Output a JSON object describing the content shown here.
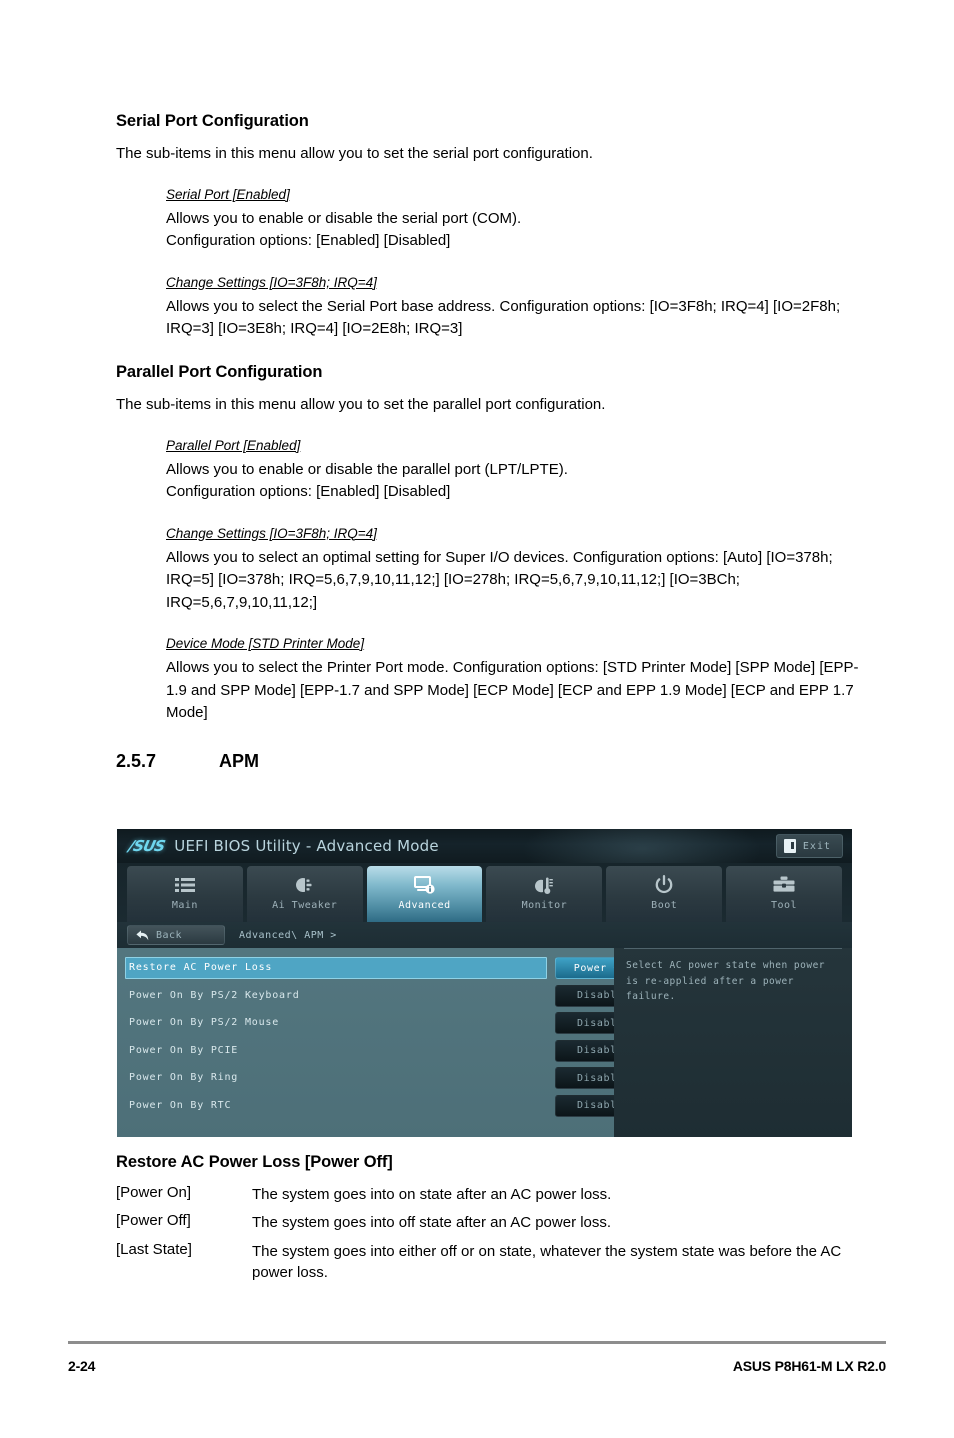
{
  "document": {
    "sections": [
      {
        "heading": "Serial Port Configuration",
        "intro": "The sub-items in this menu allow you to set the serial port configuration.",
        "items": [
          {
            "title": "Serial Port [Enabled]",
            "lines": [
              "Allows you to enable or disable the serial port (COM).",
              "Configuration options: [Enabled] [Disabled]"
            ]
          },
          {
            "title": "Change Settings [IO=3F8h; IRQ=4]",
            "lines": [
              "Allows you to select the Serial Port base address. Configuration options: [IO=3F8h; IRQ=4] [IO=2F8h; IRQ=3] [IO=3E8h; IRQ=4] [IO=2E8h; IRQ=3]"
            ]
          }
        ]
      },
      {
        "heading": "Parallel Port Configuration",
        "intro": "The sub-items in this menu allow you to set the parallel port configuration.",
        "items": [
          {
            "title": "Parallel Port [Enabled]",
            "lines": [
              "Allows you to enable or disable the parallel port (LPT/LPTE).",
              "Configuration options: [Enabled] [Disabled]"
            ]
          },
          {
            "title": "Change Settings [IO=3F8h; IRQ=4]",
            "lines": [
              "Allows you to select an optimal setting for Super I/O devices. Configuration options: [Auto] [IO=378h; IRQ=5] [IO=378h; IRQ=5,6,7,9,10,11,12;] [IO=278h; IRQ=5,6,7,9,10,11,12;] [IO=3BCh; IRQ=5,6,7,9,10,11,12;]"
            ]
          },
          {
            "title": "Device Mode [STD Printer Mode]",
            "lines": [
              "Allows you to select the Printer Port mode. Configuration options: [STD Printer Mode] [SPP Mode] [EPP-1.9 and SPP Mode] [EPP-1.7 and SPP Mode] [ECP Mode] [ECP and EPP 1.9 Mode] [ECP and EPP 1.7 Mode]"
            ]
          }
        ]
      }
    ],
    "numbered_heading": {
      "number": "2.5.7",
      "title": "APM"
    },
    "setting_heading": "Restore AC Power Loss [Power Off]",
    "definitions": [
      {
        "key": "[Power On]",
        "value": "The system goes into on state after an AC power loss."
      },
      {
        "key": "[Power Off]",
        "value": "The system goes into off state after an AC power loss."
      },
      {
        "key": "[Last State]",
        "value": "The system goes into either off or on state, whatever the system state was before the AC power loss."
      }
    ]
  },
  "bios": {
    "logo": "/SUS",
    "title": "UEFI BIOS Utility - Advanced Mode",
    "exit_label": "Exit",
    "tabs": [
      {
        "label": "Main",
        "icon": "list-icon",
        "active": false
      },
      {
        "label": "Ai Tweaker",
        "icon": "tweak-icon",
        "active": false
      },
      {
        "label": "Advanced",
        "icon": "advanced-monitor-icon",
        "active": true
      },
      {
        "label": "Monitor",
        "icon": "thermometer-fan-icon",
        "active": false
      },
      {
        "label": "Boot",
        "icon": "power-icon",
        "active": false
      },
      {
        "label": "Tool",
        "icon": "toolbox-icon",
        "active": false
      }
    ],
    "back_label": "Back",
    "breadcrumb": "Advanced\\ APM >",
    "settings": [
      {
        "name": "Restore AC Power Loss",
        "value": "Power Off",
        "selected": true
      },
      {
        "name": "Power On By PS/2 Keyboard",
        "value": "Disabled",
        "selected": false
      },
      {
        "name": "Power On By PS/2 Mouse",
        "value": "Disabled",
        "selected": false
      },
      {
        "name": "Power On By PCIE",
        "value": "Disabled",
        "selected": false
      },
      {
        "name": "Power On By Ring",
        "value": "Disabled",
        "selected": false
      },
      {
        "name": "Power On By RTC",
        "value": "Disabled",
        "selected": false
      }
    ],
    "help_text": "Select AC power state when power is re-applied after a power failure."
  },
  "footer": {
    "page_number": "2-24",
    "model": "ASUS P8H61-M LX R2.0"
  },
  "colors": {
    "accent_cyan": "#4fa5c4",
    "bios_panel": "#53767f",
    "bios_dark": "#1b2a31",
    "logo_cyan": "#6fd7ef"
  }
}
